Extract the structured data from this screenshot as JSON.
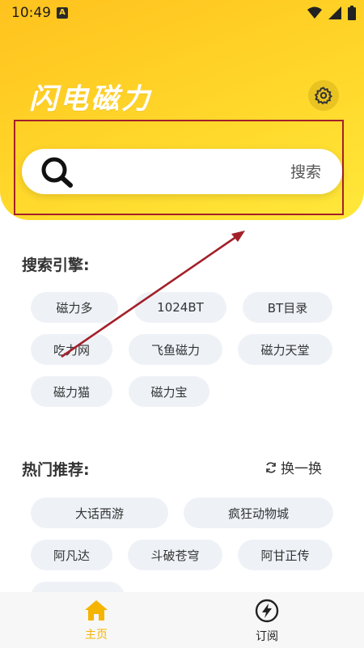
{
  "status_bar": {
    "time": "10:49",
    "badge": "A"
  },
  "header": {
    "app_title": "闪电磁力",
    "settings_icon": "gear-icon"
  },
  "search": {
    "button_label": "搜索",
    "icon": "search-icon"
  },
  "engines": {
    "title": "搜索引擎:",
    "items": [
      "磁力多",
      "1024BT",
      "BT目录",
      "吃力网",
      "飞鱼磁力",
      "磁力天堂",
      "磁力猫",
      "磁力宝"
    ]
  },
  "hot": {
    "title": "热门推荐:",
    "refresh_label": "换一换",
    "items": [
      "大话西游",
      "疯狂动物城",
      "阿凡达",
      "斗破苍穹",
      "阿甘正传"
    ]
  },
  "bottom_nav": {
    "items": [
      {
        "label": "主页",
        "icon": "home-icon",
        "active": true
      },
      {
        "label": "订阅",
        "icon": "lightning-icon",
        "active": false
      }
    ]
  },
  "colors": {
    "accent": "#ffd22a",
    "active_nav": "#f5b400",
    "annotation": "#a3202a"
  }
}
